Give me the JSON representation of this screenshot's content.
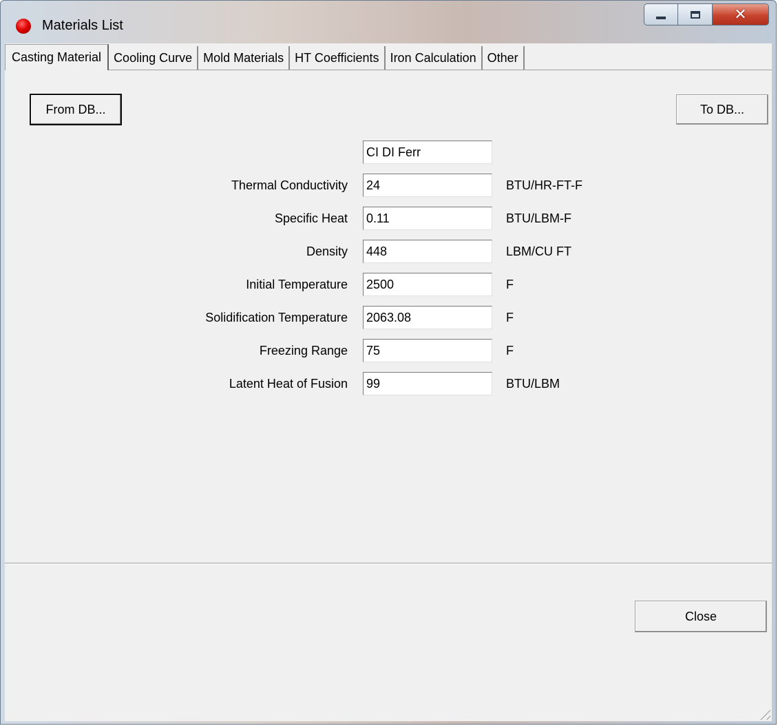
{
  "window": {
    "title": "Materials List",
    "icon": "red-ball-icon"
  },
  "tabs": [
    {
      "label": "Casting Material",
      "active": true
    },
    {
      "label": "Cooling Curve",
      "active": false
    },
    {
      "label": "Mold Materials",
      "active": false
    },
    {
      "label": "HT Coefficients",
      "active": false
    },
    {
      "label": "Iron Calculation",
      "active": false
    },
    {
      "label": "Other",
      "active": false
    }
  ],
  "buttons": {
    "from_db": "From DB...",
    "to_db": "To DB...",
    "close": "Close"
  },
  "material_name": "CI DI Ferr",
  "properties": [
    {
      "label": "Thermal Conductivity",
      "value": "24",
      "unit": "BTU/HR-FT-F"
    },
    {
      "label": "Specific Heat",
      "value": "0.11",
      "unit": "BTU/LBM-F"
    },
    {
      "label": "Density",
      "value": "448",
      "unit": "LBM/CU FT"
    },
    {
      "label": "Initial Temperature",
      "value": "2500",
      "unit": "F"
    },
    {
      "label": "Solidification Temperature",
      "value": "2063.08",
      "unit": "F"
    },
    {
      "label": "Freezing Range",
      "value": "75",
      "unit": "F"
    },
    {
      "label": "Latent Heat of Fusion",
      "value": "99",
      "unit": "BTU/LBM"
    }
  ],
  "colors": {
    "titlebar_close": "#c8452e",
    "app_icon": "#e00000"
  }
}
